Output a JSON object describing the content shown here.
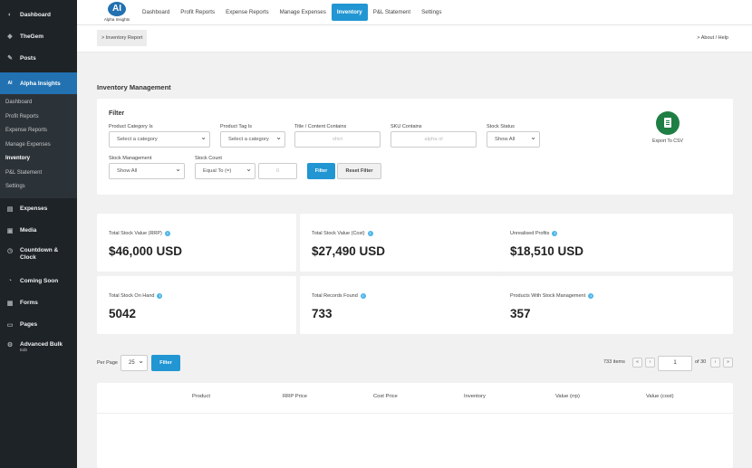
{
  "sidebar": {
    "items": [
      {
        "label": "Dashboard",
        "icon": "dashboard-icon",
        "glyph": "◐"
      },
      {
        "label": "TheGem",
        "icon": "thegem-icon",
        "glyph": "◆"
      },
      {
        "label": "Posts",
        "icon": "pin-icon",
        "glyph": "✎"
      },
      {
        "label": "Alpha Insights",
        "icon": "ai-icon",
        "glyph": "AI"
      }
    ],
    "submenu": [
      "Dashboard",
      "Profit Reports",
      "Expense Reports",
      "Manage Expenses",
      "Inventory",
      "P&L Statement",
      "Settings"
    ],
    "items_after": [
      {
        "label": "Expenses",
        "icon": "expenses-icon",
        "glyph": "▤"
      },
      {
        "label": "Media",
        "icon": "media-icon",
        "glyph": "▣"
      },
      {
        "label": "Countdown & Clock",
        "icon": "clock-icon",
        "glyph": "◷"
      },
      {
        "label": "Coming Soon",
        "icon": "coming-soon-icon",
        "glyph": "◔"
      },
      {
        "label": "Forms",
        "icon": "forms-icon",
        "glyph": "▦"
      },
      {
        "label": "Pages",
        "icon": "pages-icon",
        "glyph": "▭"
      }
    ],
    "advanced": {
      "label": "Advanced Bulk",
      "sub": "Edit",
      "glyph": "⚙"
    }
  },
  "logo": {
    "mark": "AI",
    "text": "Alpha Insights"
  },
  "nav": [
    "Dashboard",
    "Profit Reports",
    "Expense Reports",
    "Manage Expenses",
    "Inventory",
    "P&L Statement",
    "Settings"
  ],
  "breadcrumb": "> Inventory Report",
  "about": "> About / Help",
  "page_title": "Inventory Management",
  "filter": {
    "title": "Filter",
    "product_category_label": "Product Category Is",
    "product_category_value": "Select a category",
    "product_tag_label": "Product Tag Is",
    "product_tag_value": "Select a category",
    "title_contains_label": "Title / Content Contains",
    "title_contains_placeholder": "shirt",
    "sku_label": "SKU Contains",
    "sku_placeholder": "alpha-xl",
    "stock_status_label": "Stock Status",
    "stock_status_value": "Show All",
    "stock_mgmt_label": "Stock Management",
    "stock_mgmt_value": "Show All",
    "stock_count_label": "Stock Count",
    "stock_count_op": "Equal To (=)",
    "stock_count_value": "0",
    "filter_btn": "Filter",
    "reset_btn": "Reset Filter",
    "export_label": "Export To CSV"
  },
  "stats": [
    {
      "label": "Total Stock Value (RRP)",
      "value": "$46,000 USD"
    },
    {
      "label": "Total Stock Value (Cost)",
      "value": "$27,490 USD"
    },
    {
      "label": "Unrealised Profits",
      "value": "$18,510 USD"
    },
    {
      "label": "Total Stock On Hand",
      "value": "5042"
    },
    {
      "label": "Total Records Found",
      "value": "733"
    },
    {
      "label": "Products With Stock Management",
      "value": "357"
    }
  ],
  "pagination": {
    "per_page_label": "Per Page",
    "per_page_value": "25",
    "filter_btn": "Filter",
    "items": "733 items",
    "first": "«",
    "prev": "‹",
    "current": "1",
    "of": "of 30",
    "next": "›",
    "last": "»"
  },
  "table": {
    "headers": [
      "Product",
      "RRP Price",
      "Cost Price",
      "Inventory",
      "Value (rrp)",
      "Value (cost)"
    ]
  },
  "colors": {
    "accent": "#2196d3",
    "sidebar": "#1d2327",
    "export": "#1e7e44"
  }
}
